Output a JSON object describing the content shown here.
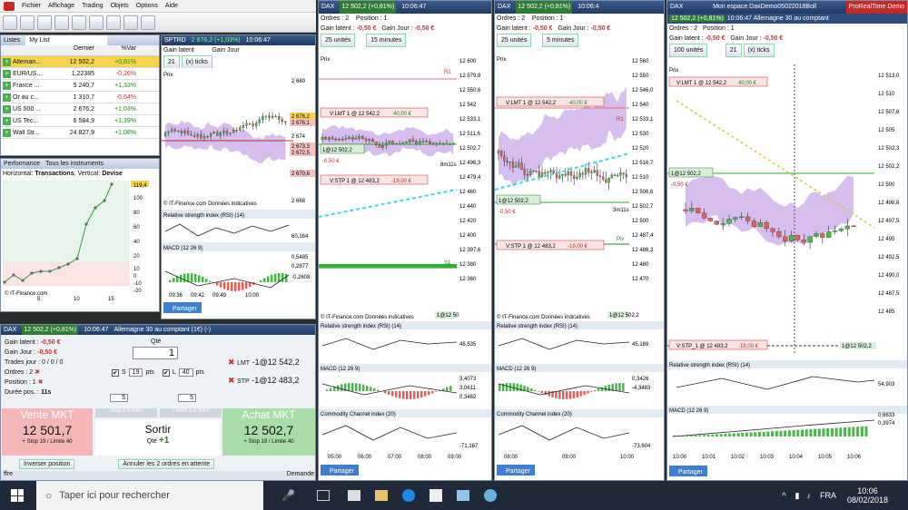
{
  "menu": [
    "Fichier",
    "Affichage",
    "Trading",
    "Objets",
    "Options",
    "Aide"
  ],
  "watchlist": {
    "title": "Listes",
    "list_name": "My List",
    "headers": [
      "Dernier",
      "%Var"
    ],
    "rows": [
      {
        "name": "Alleman...",
        "price": "12 502,2",
        "var": "+0,81%",
        "dir": "pos"
      },
      {
        "name": "EUR/US...",
        "price": "1,22385",
        "var": "-0,26%",
        "dir": "neg"
      },
      {
        "name": "France ...",
        "price": "5 240,7",
        "var": "+1,33%",
        "dir": "pos"
      },
      {
        "name": "Or au c...",
        "price": "1 310,7",
        "var": "-0,64%",
        "dir": "neg"
      },
      {
        "name": "US 500 ...",
        "price": "2 676,2",
        "var": "+1,03%",
        "dir": "pos"
      },
      {
        "name": "US Tec...",
        "price": "6 584,9",
        "var": "+1,39%",
        "dir": "pos"
      },
      {
        "name": "Wall Str...",
        "price": "24 827,9",
        "var": "+1,08%",
        "dir": "pos"
      }
    ]
  },
  "perf": {
    "title": "Performance",
    "tab2": "Tous les instruments",
    "subtitle_a": "Horizontal: ",
    "subtitle_b": "Transactions",
    "subtitle_c": ", Vertical: ",
    "subtitle_d": "Devise",
    "y_ticks": [
      "119,4",
      "100",
      "80",
      "60",
      "40",
      "20",
      "10",
      "0",
      "-10",
      "-20"
    ],
    "x_ticks": [
      "5",
      "10",
      "15"
    ],
    "footer": "© IT-Finance.com"
  },
  "sptrd": {
    "title": "SPTRD",
    "price": "2 676,2 (+1,03%)",
    "time": "10:06:47",
    "gain_latent": "Gain latent",
    "gain_jour": "Gain Jour",
    "units": "21",
    "units_type": "(x) ticks",
    "prix": "Prix",
    "y_labels": [
      "2 680",
      "2 676,2",
      "2 676,1",
      "2 674",
      "2 673,3",
      "2 672,5",
      "2 670,6",
      "2 668"
    ],
    "rsi": "Relative strength index (RSI) (14)",
    "rsi_val": "60,164",
    "macd": "MACD (12 26 9)",
    "macd_vals": [
      "0,5485",
      "0,2877",
      "-0,2608"
    ],
    "x_ticks": [
      "09:36",
      "09:42",
      "09:49",
      "10:00"
    ],
    "copyright": "© IT-Finance.com Données indicatives",
    "partager": "Partager"
  },
  "order_ticket": {
    "title": "DAX",
    "price": "12 502,2 (+0,81%)",
    "time": "10:06:47",
    "name": "Allemagne 30 au comptant (1€) (-)",
    "gain_latent_label": "Gain latent :",
    "gain_latent": "-0,50 €",
    "gain_jour_label": "Gain Jour :",
    "gain_jour": "-0,50 €",
    "trades_jour_label": "Trades jour :",
    "trades_jour": "0 / 0 / 0",
    "ordres_label": "Ordres :",
    "ordres": "2",
    "position_label": "Position :",
    "position": "1",
    "duree_label": "Durée pos. :",
    "duree": "11s",
    "qte_label": "Qté",
    "qte": "1",
    "s_label": "S",
    "s_val": "19",
    "l_label": "L",
    "l_val": "40",
    "pts": "pts",
    "spin1": "5",
    "spin2": "5",
    "lmt_label": "LMT",
    "lmt": "-1@12 542,2",
    "stp_label": "STP",
    "stp": "-1@12 483,2",
    "stop5": "Stop à 5 ticks",
    "limit5": "Limite à 5 ticks",
    "vente_label": "Vente MKT",
    "vente": "12 501,7",
    "vente_sub": "+ Stop 19 / Limite 40",
    "sortir": "Sortir",
    "qte2_label": "Qté",
    "qte2": "+1",
    "achat_label": "Achat MKT",
    "achat": "12 502,7",
    "achat_sub": "+ Stop 19 / Limite 40",
    "inverser": "Inverser position",
    "annuler": "Annuler les 2 ordres en attente",
    "demande": "Demande",
    "footer_left": "ffre"
  },
  "dax_panels": [
    {
      "id": "p1",
      "title": "DAX",
      "price": "12 502,2 (+0,81%)",
      "time": "10:06:47",
      "ordres": "2",
      "position": "1",
      "gain_latent": "-0,50 €",
      "gain_jour": "-0,50 €",
      "units": "25 unités",
      "interval": "15 minutes",
      "y_labels": [
        "12 600",
        "12 579,8",
        "12 550,6",
        "12 542",
        "12 533,1",
        "12 511,6",
        "12 502,7",
        "12 496,3",
        "12 479,4",
        "12 460",
        "12 440",
        "12 420",
        "12 400",
        "12 397,6",
        "12 380",
        "12 360"
      ],
      "vlmt": "V:LMT 1 @ 12 542,2",
      "vlmt_val": "40,00 €",
      "pos_box": "1@12 502,2",
      "pos_val": "-0,50 €",
      "vstp": "V:STP 1 @ 12 483,2",
      "vstp_val": "-19,00 €",
      "timer": "8m11s",
      "r1": "R1",
      "s1": "S1",
      "rsi": "Relative strength index (RSI) (14)",
      "rsi_val": "48,535",
      "macd": "MACD (12 26 9)",
      "macd_vals": [
        "3,4073",
        "3,0611",
        "0,3462"
      ],
      "cci": "Commodity Channel index (20)",
      "cci_val": "-71,187",
      "x_ticks": [
        "05:00",
        "06:00",
        "07:00",
        "08:00",
        "09:00"
      ],
      "copyright": "© IT-Finance.com Données indicatives",
      "last_tag": "1@12 50",
      "partager": "Partager"
    },
    {
      "id": "p2",
      "title": "DAX",
      "price": "12 502,2 (+0,81%)",
      "time": "10:06:4",
      "ordres": "2",
      "position": "1",
      "gain_latent": "-0,50 €",
      "gain_jour": "-0,50 €",
      "units": "25 unités",
      "interval": "5 minutes",
      "y_labels": [
        "12 560",
        "12 550",
        "12 546,0",
        "12 540",
        "12 533,1",
        "12 530",
        "12 520",
        "12 516,7",
        "12 510",
        "12 506,6",
        "12 502,7",
        "12 500",
        "12 487,4",
        "12 486,3",
        "12 480",
        "12 470"
      ],
      "vlmt": "V:LMT 1 @ 12 542,2",
      "vlmt_val": "40,00 €",
      "pos_box": "1@12 502,2",
      "pos_val": "-0,50 €",
      "vstp": "V:STP 1 @ 12 483,2",
      "vstp_val": "-19,00 €",
      "timer": "3m11s",
      "r1": "R1",
      "s1": "Piv",
      "rsi": "Relative strength index (RSI) (14)",
      "rsi_val": "45,189",
      "macd": "MACD (12 26 9)",
      "macd_vals": [
        "0,3426",
        "-4,3483"
      ],
      "cci": "Commodity Channel index (20)",
      "cci_val": "-73,604",
      "x_ticks": [
        "08:00",
        "09:00",
        "10:00"
      ],
      "copyright": "© IT-Finance.com Données indicatives",
      "last_tag": "1@12 502,2",
      "partager": "Partager"
    }
  ],
  "main_panel": {
    "title": "DAX",
    "workspace": "Mon espace DaxDemo05022018Boll",
    "brand": "ProRealTime Demo",
    "price": "12 502,2 (+0,81%)",
    "time": "10:06:47",
    "name": "Allemagne 30 au comptant",
    "ordres": "2",
    "position": "1",
    "gain_latent": "-0,50 €",
    "gain_jour": "-0,50 €",
    "units": "100 unités",
    "ticks": "21",
    "ticks_type": "(x) ticks",
    "y_labels": [
      "12 513,0",
      "12 510",
      "12 507,6",
      "12 505",
      "12 502,3",
      "12 502,2",
      "12 500",
      "12 498,8",
      "12 497,5",
      "12 495",
      "12 492,5",
      "12 490,0",
      "12 487,5",
      "12 485"
    ],
    "vlmt": "V:LMT 1 @ 12 542,2",
    "vlmt_val": "40,00 €",
    "pos_box": "1@12 502,2",
    "pos_val": "-0,50 €",
    "vstp": "V:STP_1 @ 12 483,2",
    "vstp_val": "-19,00 €",
    "rsi": "Relative strength index (RSI) (14)",
    "rsi_val": "54,903",
    "macd": "MACD (12 26 9)",
    "macd_vals": [
      "0,6633",
      "0,3974"
    ],
    "x_ticks": [
      "10:00",
      "10:01",
      "10:02",
      "10:03",
      "10:04",
      "10:05",
      "10:06"
    ],
    "last_tag": "1@12 502,2",
    "partager": "Partager"
  },
  "taskbar": {
    "search": "Taper ici pour rechercher",
    "lang": "FRA",
    "time": "10:06",
    "date": "08/02/2018"
  }
}
